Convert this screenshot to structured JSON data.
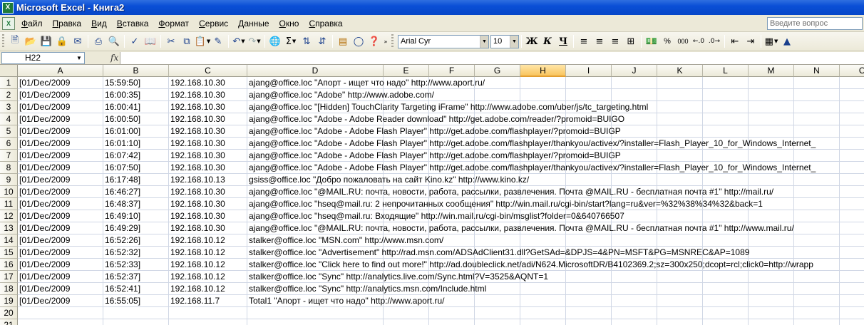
{
  "window": {
    "title": "Microsoft Excel - Книга2",
    "app_icon": "excel-icon"
  },
  "menu": {
    "items": [
      "Файл",
      "Правка",
      "Вид",
      "Вставка",
      "Формат",
      "Сервис",
      "Данные",
      "Окно",
      "Справка"
    ],
    "help_placeholder": "Введите вопрос"
  },
  "toolbar": {
    "font_name": "Arial Cyr",
    "font_size": "10",
    "bold_label": "Ж",
    "italic_label": "К",
    "underline_label": "Ч",
    "percent_label": "%",
    "thousands_label": "000"
  },
  "formula_bar": {
    "name_box": "H22",
    "fx_label": "fx",
    "formula": ""
  },
  "sheet": {
    "columns": [
      "A",
      "B",
      "C",
      "D",
      "E",
      "F",
      "G",
      "H",
      "I",
      "J",
      "K",
      "L",
      "M",
      "N",
      "O"
    ],
    "active_column": "H",
    "active_row": 22,
    "row_numbers": [
      "1",
      "2",
      "3",
      "4",
      "5",
      "6",
      "7",
      "8",
      "9",
      "10",
      "11",
      "12",
      "13",
      "14",
      "15",
      "16",
      "17",
      "18",
      "19",
      "20",
      "21"
    ],
    "rows": [
      [
        "[01/Dec/2009",
        "15:59:50]",
        "192.168.10.30",
        "ajang@office.loc \"Апорт - ищет что надо\" http://www.aport.ru/"
      ],
      [
        "[01/Dec/2009",
        "16:00:35]",
        "192.168.10.30",
        "ajang@office.loc \"Adobe\" http://www.adobe.com/"
      ],
      [
        "[01/Dec/2009",
        "16:00:41]",
        "192.168.10.30",
        "ajang@office.loc \"[Hidden] TouchClarity Targeting iFrame\" http://www.adobe.com/uber/js/tc_targeting.html"
      ],
      [
        "[01/Dec/2009",
        "16:00:50]",
        "192.168.10.30",
        "ajang@office.loc \"Adobe - Adobe Reader download\" http://get.adobe.com/reader/?promoid=BUIGO"
      ],
      [
        "[01/Dec/2009",
        "16:01:00]",
        "192.168.10.30",
        "ajang@office.loc \"Adobe - Adobe Flash Player\" http://get.adobe.com/flashplayer/?promoid=BUIGP"
      ],
      [
        "[01/Dec/2009",
        "16:01:10]",
        "192.168.10.30",
        "ajang@office.loc \"Adobe - Adobe Flash Player\" http://get.adobe.com/flashplayer/thankyou/activex/?installer=Flash_Player_10_for_Windows_Internet_"
      ],
      [
        "[01/Dec/2009",
        "16:07:42]",
        "192.168.10.30",
        "ajang@office.loc \"Adobe - Adobe Flash Player\" http://get.adobe.com/flashplayer/?promoid=BUIGP"
      ],
      [
        "[01/Dec/2009",
        "16:07:50]",
        "192.168.10.30",
        "ajang@office.loc \"Adobe - Adobe Flash Player\" http://get.adobe.com/flashplayer/thankyou/activex/?installer=Flash_Player_10_for_Windows_Internet_"
      ],
      [
        "[01/Dec/2009",
        "16:17:48]",
        "192.168.10.13",
        "gsiss@office.loc \"Добро пожаловать на сайт Kino.kz\" http://www.kino.kz/"
      ],
      [
        "[01/Dec/2009",
        "16:46:27]",
        "192.168.10.30",
        "ajang@office.loc \"@MAIL.RU: почта, новости, работа, рассылки, развлечения. Почта @MAIL.RU - бесплатная почта #1\" http://mail.ru/"
      ],
      [
        "[01/Dec/2009",
        "16:48:37]",
        "192.168.10.30",
        "ajang@office.loc \"hseq@mail.ru: 2 непрочитанных сообщения\" http://win.mail.ru/cgi-bin/start?lang=ru&ver=%32%38%34%32&back=1"
      ],
      [
        "[01/Dec/2009",
        "16:49:10]",
        "192.168.10.30",
        "ajang@office.loc \"hseq@mail.ru: Входящие\" http://win.mail.ru/cgi-bin/msglist?folder=0&640766507"
      ],
      [
        "[01/Dec/2009",
        "16:49:29]",
        "192.168.10.30",
        "ajang@office.loc \"@MAIL.RU: почта, новости, работа, рассылки, развлечения. Почта @MAIL.RU - бесплатная почта #1\" http://www.mail.ru/"
      ],
      [
        "[01/Dec/2009",
        "16:52:26]",
        "192.168.10.12",
        "stalker@office.loc \"MSN.com\" http://www.msn.com/"
      ],
      [
        "[01/Dec/2009",
        "16:52:32]",
        "192.168.10.12",
        "stalker@office.loc \"Advertisement\" http://rad.msn.com/ADSAdClient31.dll?GetSAd=&DPJS=4&PN=MSFT&PG=MSNREC&AP=1089"
      ],
      [
        "[01/Dec/2009",
        "16:52:33]",
        "192.168.10.12",
        "stalker@office.loc \"Click here to find out more!\" http://ad.doubleclick.net/adi/N624.MicrosoftDR/B4102369.2;sz=300x250;dcopt=rcl;click0=http://wrapp"
      ],
      [
        "[01/Dec/2009",
        "16:52:37]",
        "192.168.10.12",
        "stalker@office.loc \"Sync\" http://analytics.live.com/Sync.html?V=3525&AQNT=1"
      ],
      [
        "[01/Dec/2009",
        "16:52:41]",
        "192.168.10.12",
        "stalker@office.loc \"Sync\" http://analytics.msn.com/Include.html"
      ],
      [
        "[01/Dec/2009",
        "16:55:05]",
        "192.168.11.7",
        "Total1 \"Апорт - ищет что надо\" http://www.aport.ru/"
      ],
      [
        "",
        "",
        "",
        ""
      ],
      [
        "",
        "",
        "",
        ""
      ]
    ]
  }
}
